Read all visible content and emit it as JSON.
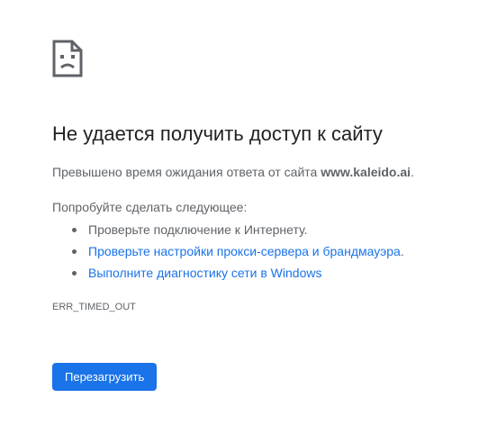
{
  "error": {
    "icon": "sad-page-icon",
    "title": "Не удается получить доступ к сайту",
    "summary_prefix": "Превышено время ожидания ответа от сайта ",
    "summary_host": "www.kaleido.ai",
    "summary_suffix": ".",
    "suggestions_heading": "Попробуйте сделать следующее:",
    "suggestions": [
      {
        "text": "Проверьте подключение к Интернету.",
        "is_link": false
      },
      {
        "text": "Проверьте настройки прокси-сервера и брандмауэра",
        "is_link": true,
        "trailing": "."
      },
      {
        "text": "Выполните диагностику сети в Windows",
        "is_link": true,
        "trailing": ""
      }
    ],
    "error_code": "ERR_TIMED_OUT",
    "reload_label": "Перезагрузить"
  },
  "colors": {
    "link": "#1a73e8",
    "button": "#1a73e8",
    "text_primary": "#202124",
    "text_secondary": "#5f6368"
  }
}
